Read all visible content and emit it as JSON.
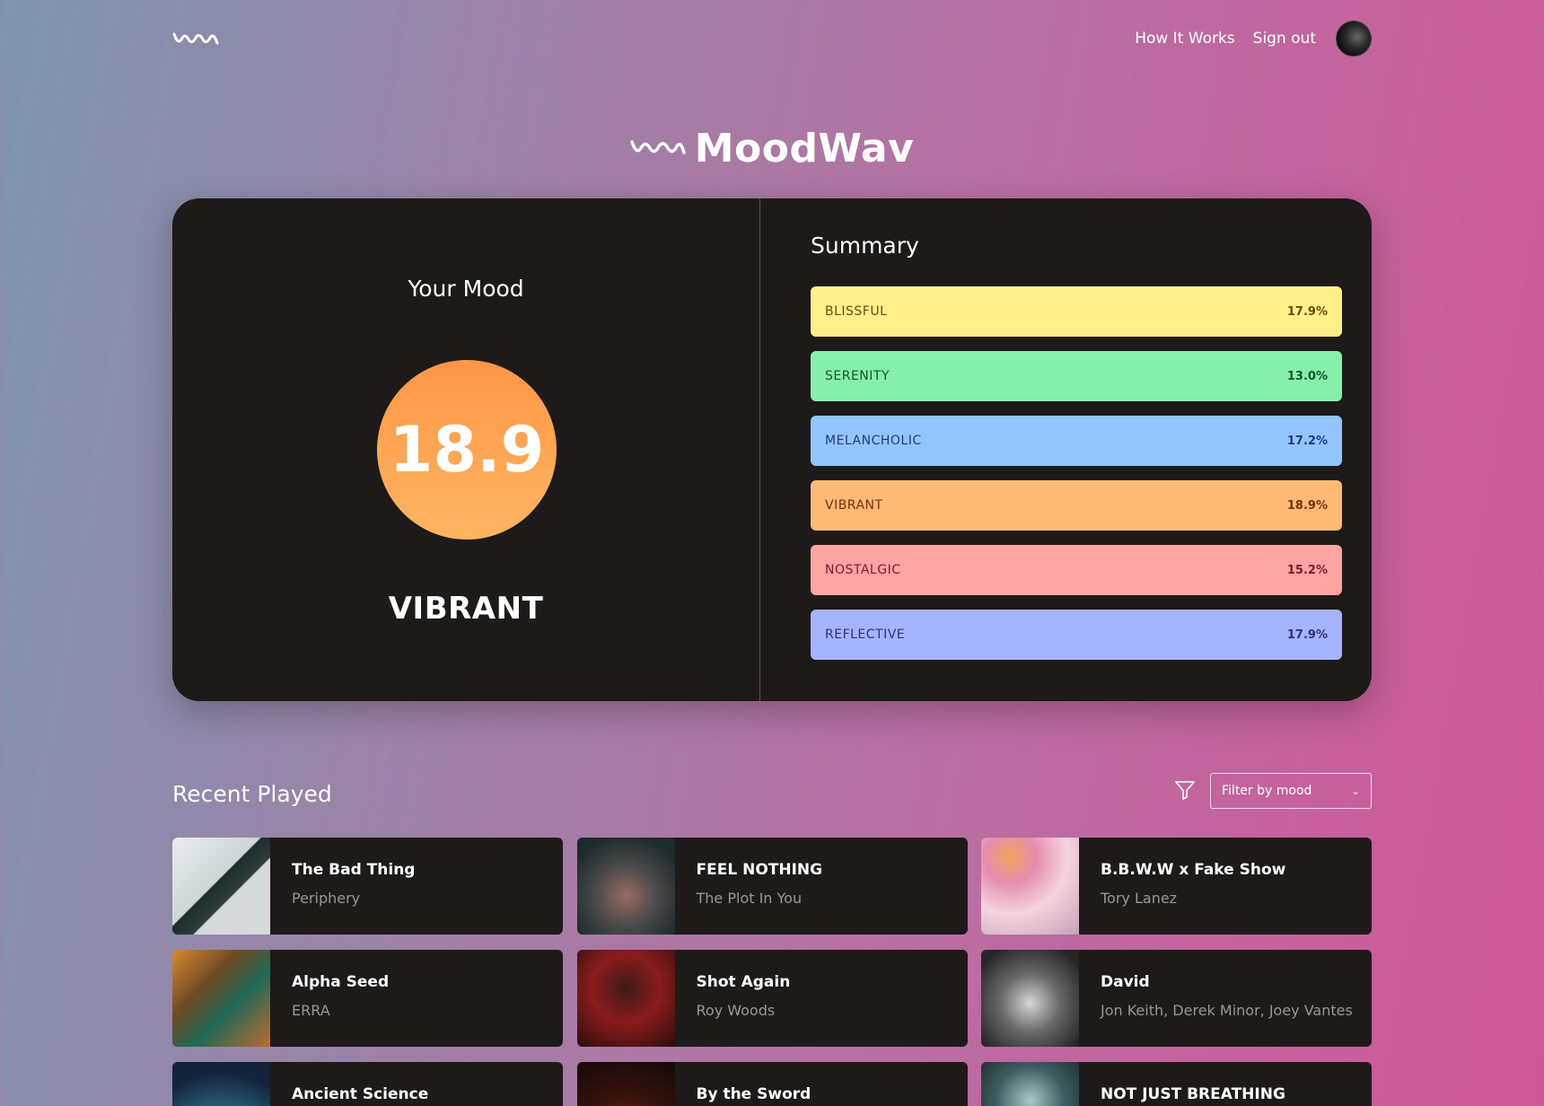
{
  "nav": {
    "how_it_works": "How It Works",
    "sign_out": "Sign out"
  },
  "brand": {
    "name": "MoodWav"
  },
  "mood": {
    "title": "Your Mood",
    "score": "18.9",
    "name": "VIBRANT",
    "score_color": "#fd9646"
  },
  "summary": {
    "title": "Summary",
    "items": [
      {
        "label": "BLISSFUL",
        "value": "17.9%",
        "color": "#fff08a",
        "text_color": "#6b4a10"
      },
      {
        "label": "SERENITY",
        "value": "13.0%",
        "color": "#86efac",
        "text_color": "#14532d"
      },
      {
        "label": "MELANCHOLIC",
        "value": "17.2%",
        "color": "#93c5fd",
        "text_color": "#1e3a8a"
      },
      {
        "label": "VIBRANT",
        "value": "18.9%",
        "color": "#fdba74",
        "text_color": "#7c2d12"
      },
      {
        "label": "NOSTALGIC",
        "value": "15.2%",
        "color": "#fca5a5",
        "text_color": "#7f1d1d"
      },
      {
        "label": "REFLECTIVE",
        "value": "17.9%",
        "color": "#a5b4fc",
        "text_color": "#312e81"
      }
    ]
  },
  "recent": {
    "title": "Recent Played",
    "filter_placeholder": "Filter by mood",
    "tracks": [
      {
        "title": "The Bad Thing",
        "artist": "Periphery"
      },
      {
        "title": "FEEL NOTHING",
        "artist": "The Plot In You"
      },
      {
        "title": "B.B.W.W x Fake Show",
        "artist": "Tory Lanez"
      },
      {
        "title": "Alpha Seed",
        "artist": "ERRA"
      },
      {
        "title": "Shot Again",
        "artist": "Roy Woods"
      },
      {
        "title": "David",
        "artist": "Jon Keith, Derek Minor, Joey Vantes"
      },
      {
        "title": "Ancient Science",
        "artist": ""
      },
      {
        "title": "By the Sword",
        "artist": ""
      },
      {
        "title": "NOT JUST BREATHING",
        "artist": ""
      }
    ]
  }
}
